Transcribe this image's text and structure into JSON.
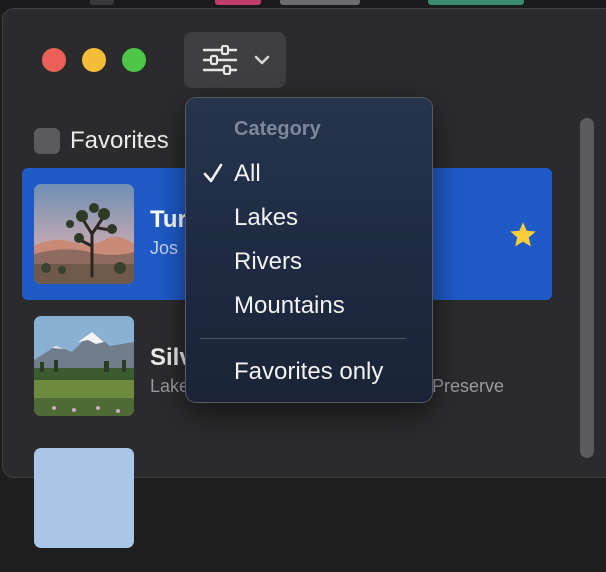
{
  "toolbar": {
    "filter_icon": "sliders-icon",
    "chevron_icon": "chevron-down-icon"
  },
  "sidebar": {
    "favorites_label": "Favorites"
  },
  "list": {
    "items": [
      {
        "title": "Tur",
        "subtitle": "Jos",
        "favorite": true,
        "selected": true
      },
      {
        "title": "Silv",
        "subtitle": "Lake",
        "subtitle_tail": "Preserve",
        "favorite": false,
        "selected": false
      }
    ]
  },
  "menu": {
    "header": "Category",
    "options": [
      {
        "label": "All",
        "checked": true
      },
      {
        "label": "Lakes",
        "checked": false
      },
      {
        "label": "Rivers",
        "checked": false
      },
      {
        "label": "Mountains",
        "checked": false
      }
    ],
    "favorites_only": "Favorites only"
  },
  "colors": {
    "selection": "#1f5ac7",
    "star": "#f7cd3b",
    "close": "#ec5f58",
    "minimize": "#f4bd39",
    "zoom": "#4ec546"
  }
}
